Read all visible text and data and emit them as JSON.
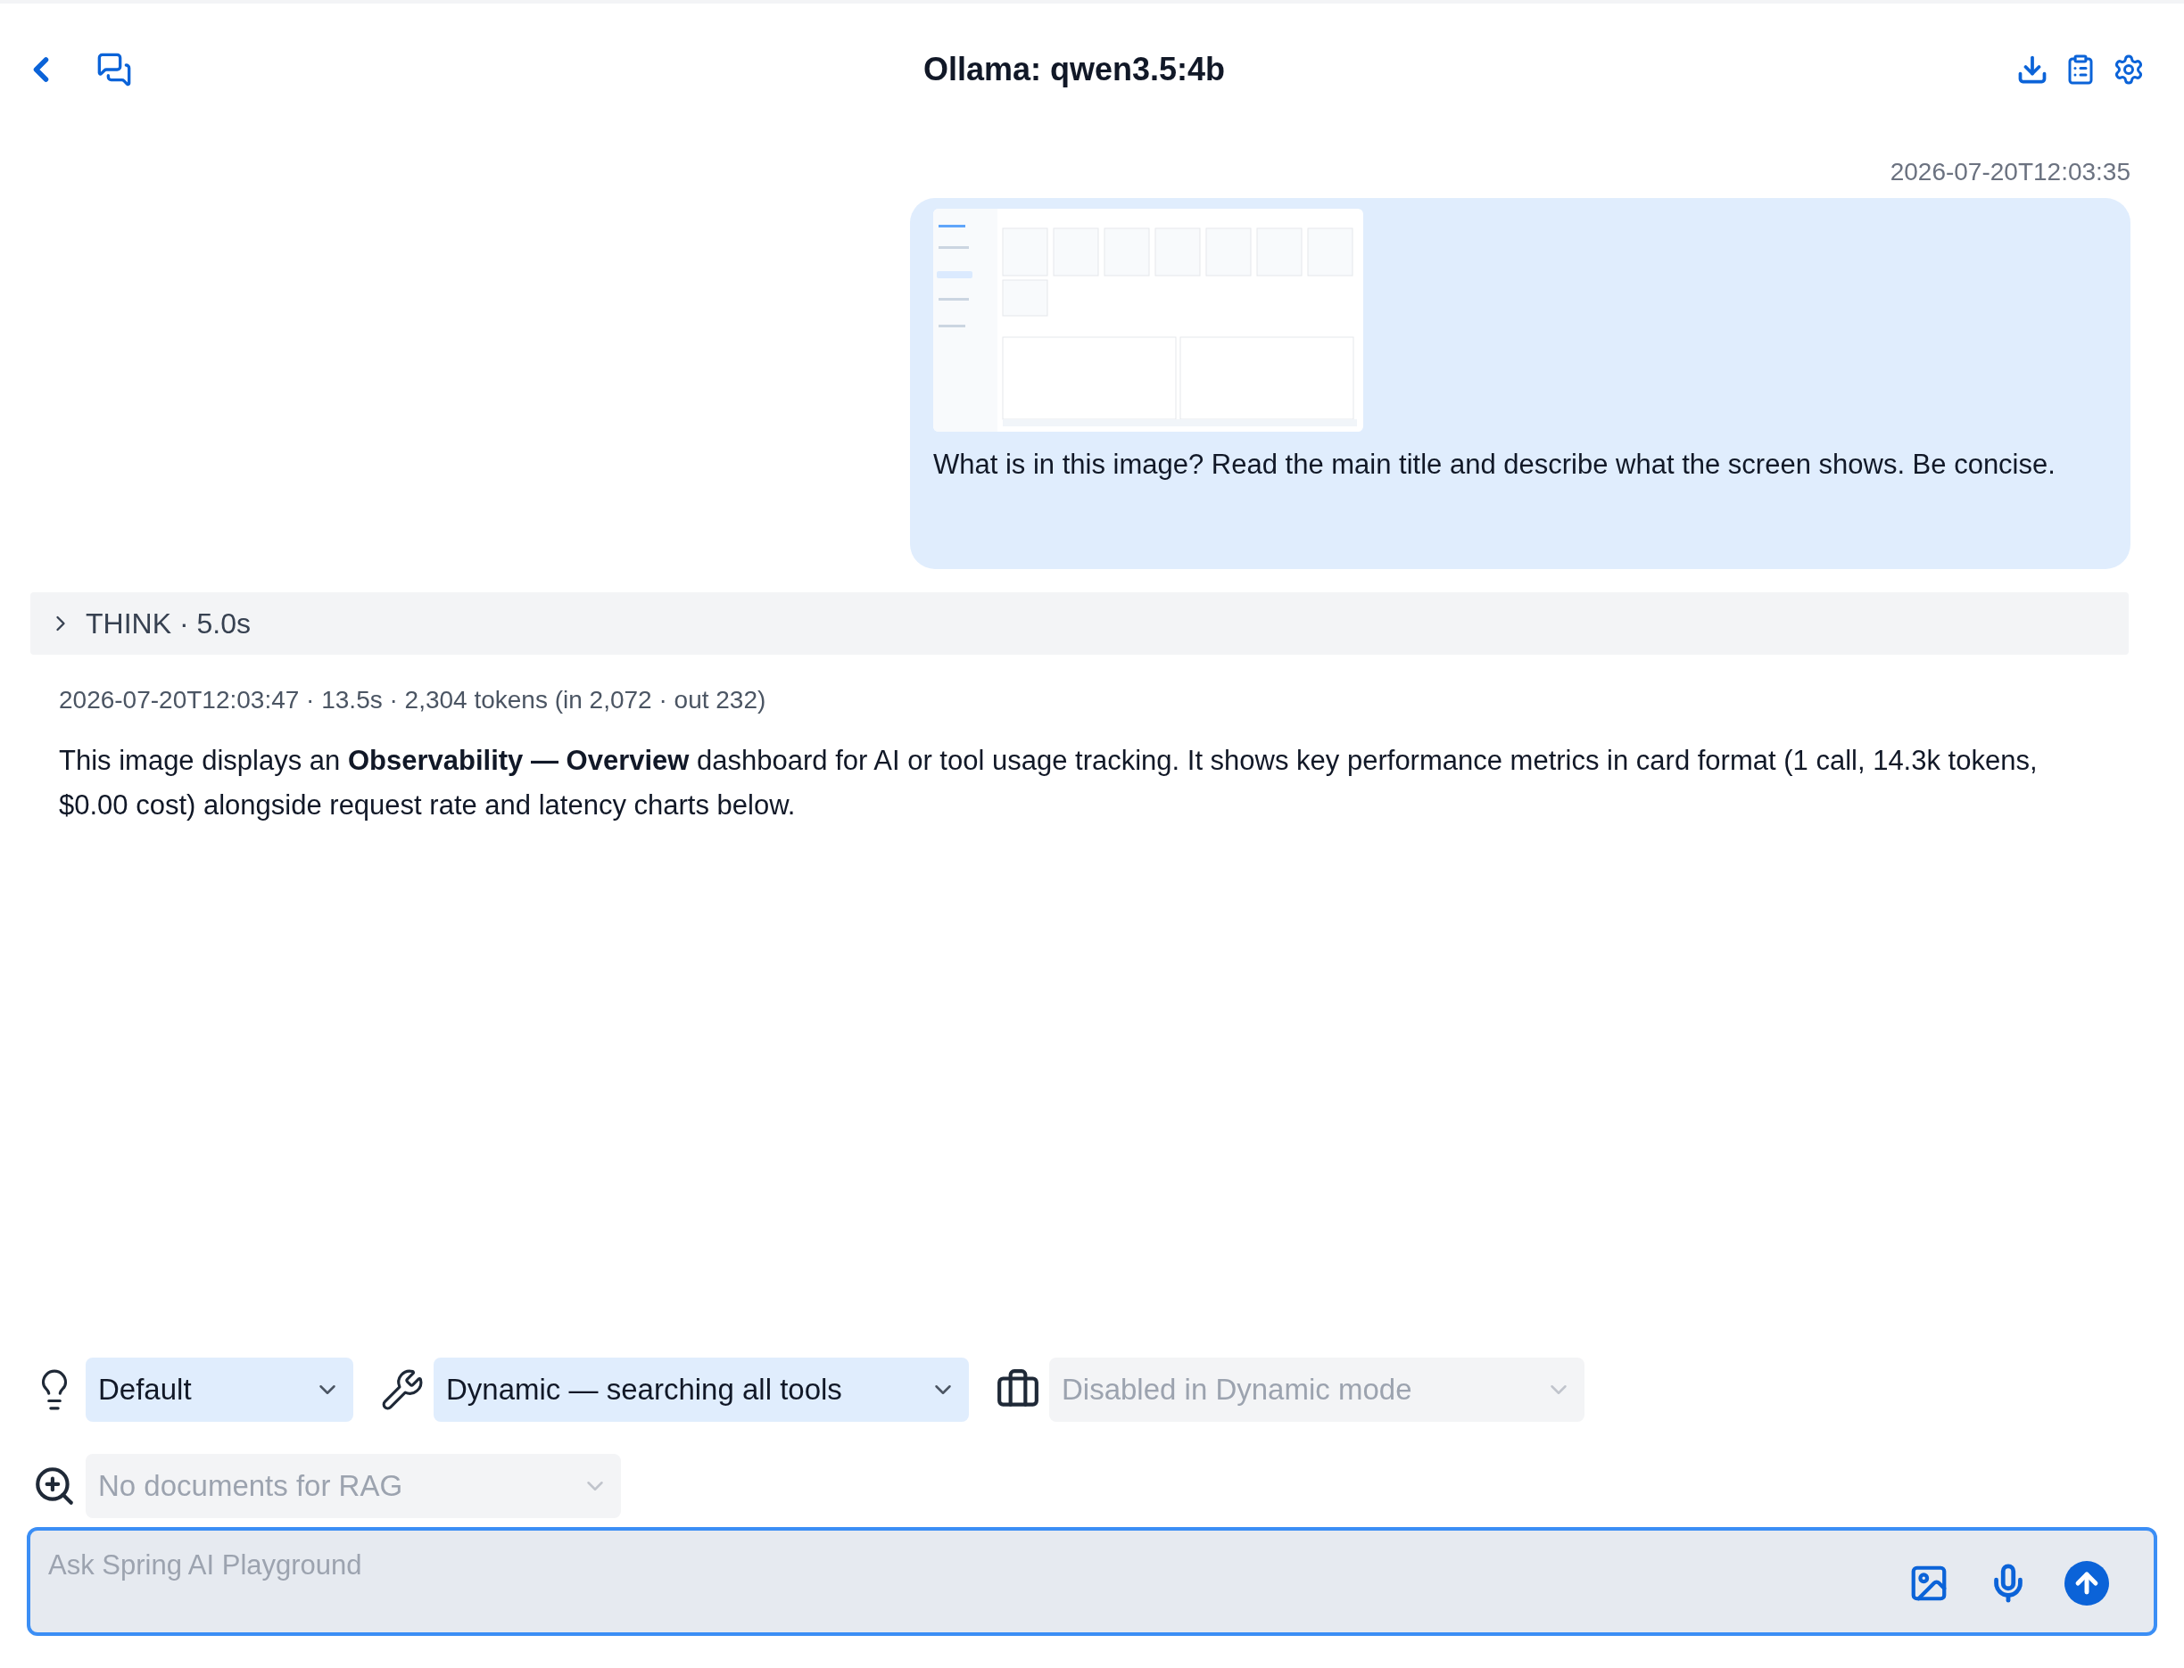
{
  "header": {
    "title": "Ollama: qwen3.5:4b"
  },
  "messages": [
    {
      "kind": "user",
      "timestamp": "2026-07-20T12:03:35",
      "text": "What is in this image? Read the main title and describe what the screen shows. Be concise."
    },
    {
      "kind": "assistant",
      "think": {
        "label": "THINK · 5.0s",
        "expanded": false
      },
      "meta": "2026-07-20T12:03:47 · 13.5s · 2,304 tokens (in 2,072 · out 232)",
      "text": "This image displays an **Observability — Overview** dashboard for AI or tool usage tracking. It shows key performance metrics in card format (1 call, 14.3k tokens, $0.00 cost) alongside request rate and latency charts below."
    }
  ],
  "selects": [
    {
      "kind": "prompt",
      "value": "Default",
      "disabled": false
    },
    {
      "kind": "tools",
      "value": "Dynamic — searching all tools",
      "disabled": false
    },
    {
      "kind": "toolbox",
      "value": "Disabled in Dynamic mode",
      "disabled": true
    },
    {
      "kind": "rag",
      "value": "No documents for RAG",
      "disabled": true
    }
  ],
  "composer": {
    "placeholder": "Ask Spring AI Playground"
  }
}
